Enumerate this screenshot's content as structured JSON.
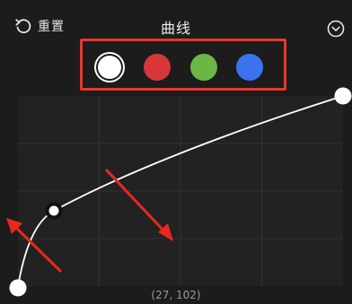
{
  "header": {
    "reset_label": "重置",
    "title": "曲线"
  },
  "channels": [
    {
      "name": "white",
      "color": "#ffffff",
      "selected": true
    },
    {
      "name": "red",
      "color": "#d8373a"
    },
    {
      "name": "green",
      "color": "#6cb744"
    },
    {
      "name": "blue",
      "color": "#3b72f0"
    }
  ],
  "curve": {
    "readout": "(27, 102)"
  },
  "colors": {
    "background": "#1c1c1c",
    "highlight_box": "#e23a2e",
    "annotation_arrow": "#e8291c"
  }
}
